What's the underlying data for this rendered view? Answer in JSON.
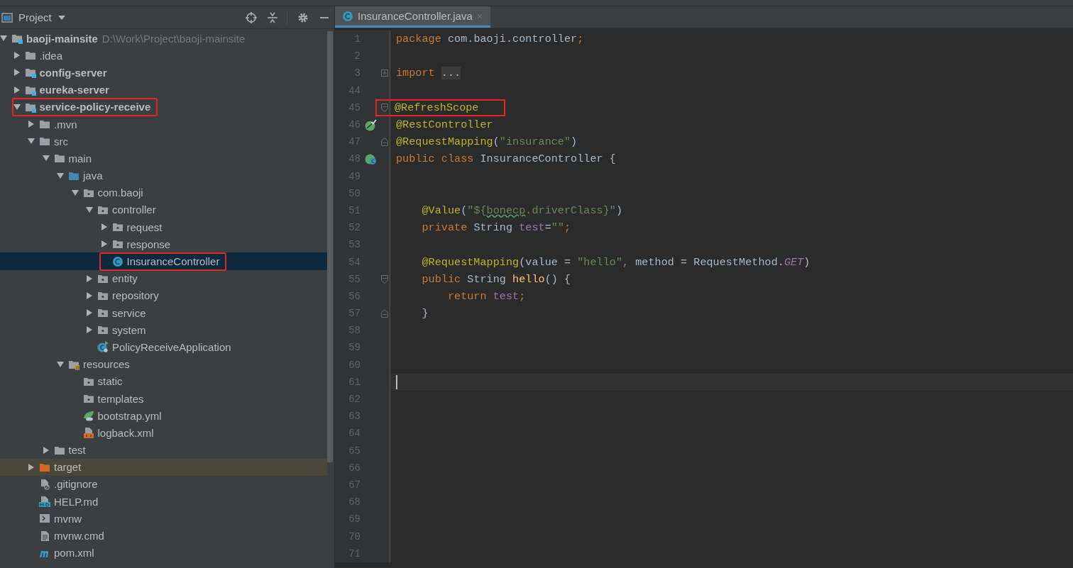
{
  "project_panel": {
    "title": "Project",
    "tree": [
      {
        "label": "baoji-mainsite",
        "kind": "module",
        "path": "D:\\Work\\Project\\baoji-mainsite",
        "expanded": true,
        "selected": false,
        "highlighted": false,
        "children": [
          {
            "label": ".idea",
            "kind": "folder",
            "expanded": false,
            "selected": false,
            "highlighted": false
          },
          {
            "label": "config-server",
            "kind": "module",
            "expanded": false,
            "selected": false,
            "highlighted": false
          },
          {
            "label": "eureka-server",
            "kind": "module",
            "expanded": false,
            "selected": false,
            "highlighted": false
          },
          {
            "label": "service-policy-receive",
            "kind": "module",
            "expanded": true,
            "selected": false,
            "highlighted": true,
            "children": [
              {
                "label": ".mvn",
                "kind": "folder",
                "expanded": false,
                "selected": false,
                "highlighted": false
              },
              {
                "label": "src",
                "kind": "folder",
                "expanded": true,
                "selected": false,
                "highlighted": false,
                "children": [
                  {
                    "label": "main",
                    "kind": "folder",
                    "expanded": true,
                    "selected": false,
                    "highlighted": false,
                    "children": [
                      {
                        "label": "java",
                        "kind": "source",
                        "expanded": true,
                        "selected": false,
                        "highlighted": false,
                        "children": [
                          {
                            "label": "com.baoji",
                            "kind": "package",
                            "expanded": true,
                            "selected": false,
                            "highlighted": false,
                            "children": [
                              {
                                "label": "controller",
                                "kind": "package",
                                "expanded": true,
                                "selected": false,
                                "highlighted": false,
                                "children": [
                                  {
                                    "label": "request",
                                    "kind": "package",
                                    "expanded": false,
                                    "selected": false,
                                    "highlighted": false
                                  },
                                  {
                                    "label": "response",
                                    "kind": "package",
                                    "expanded": false,
                                    "selected": false,
                                    "highlighted": false
                                  },
                                  {
                                    "label": "InsuranceController",
                                    "kind": "class",
                                    "selected": true,
                                    "highlighted": true
                                  }
                                ]
                              },
                              {
                                "label": "entity",
                                "kind": "package",
                                "expanded": false,
                                "selected": false,
                                "highlighted": false
                              },
                              {
                                "label": "repository",
                                "kind": "package",
                                "expanded": false,
                                "selected": false,
                                "highlighted": false
                              },
                              {
                                "label": "service",
                                "kind": "package",
                                "expanded": false,
                                "selected": false,
                                "highlighted": false
                              },
                              {
                                "label": "system",
                                "kind": "package",
                                "expanded": false,
                                "selected": false,
                                "highlighted": false
                              },
                              {
                                "label": "PolicyReceiveApplication",
                                "kind": "appclass",
                                "selected": false,
                                "highlighted": false
                              }
                            ]
                          }
                        ]
                      },
                      {
                        "label": "resources",
                        "kind": "resources",
                        "expanded": true,
                        "selected": false,
                        "highlighted": false,
                        "children": [
                          {
                            "label": "static",
                            "kind": "package",
                            "selected": false,
                            "highlighted": false
                          },
                          {
                            "label": "templates",
                            "kind": "package",
                            "selected": false,
                            "highlighted": false
                          },
                          {
                            "label": "bootstrap.yml",
                            "kind": "yml",
                            "selected": false,
                            "highlighted": false
                          },
                          {
                            "label": "logback.xml",
                            "kind": "xml",
                            "selected": false,
                            "highlighted": false
                          }
                        ]
                      }
                    ]
                  },
                  {
                    "label": "test",
                    "kind": "folder",
                    "expanded": false,
                    "selected": false,
                    "highlighted": false
                  }
                ]
              },
              {
                "label": "target",
                "kind": "excluded",
                "expanded": false,
                "selected": false,
                "highlighted": false
              },
              {
                "label": ".gitignore",
                "kind": "gitignore",
                "selected": false,
                "highlighted": false
              },
              {
                "label": "HELP.md",
                "kind": "md",
                "selected": false,
                "highlighted": false
              },
              {
                "label": "mvnw",
                "kind": "script",
                "selected": false,
                "highlighted": false
              },
              {
                "label": "mvnw.cmd",
                "kind": "cmd",
                "selected": false,
                "highlighted": false
              },
              {
                "label": "pom.xml",
                "kind": "maven",
                "selected": false,
                "highlighted": false
              }
            ]
          }
        ]
      }
    ]
  },
  "editor": {
    "tabs": [
      {
        "label": "InsuranceController.java",
        "close": "×",
        "selected": true
      }
    ],
    "lines": [
      {
        "number": "1",
        "tokens": [
          {
            "t": "package ",
            "kind": "kw"
          },
          {
            "t": "com.baoji.controller",
            "kind": "plain"
          },
          {
            "t": ";",
            "kind": "kw"
          }
        ]
      },
      {
        "number": "2"
      },
      {
        "number": "3",
        "fold": {
          "kind": "plus"
        },
        "tokens": [
          {
            "t": "import ",
            "kind": "kw"
          },
          {
            "t": "...",
            "kind": "folded"
          }
        ]
      },
      {
        "number": "44"
      },
      {
        "number": "45",
        "fold": {
          "kind": "start"
        },
        "highlighted": true,
        "tokens": [
          {
            "t": "@RefreshScope",
            "kind": "ann"
          }
        ]
      },
      {
        "number": "46",
        "gutter_icon": {
          "kind": "bean"
        },
        "tokens": [
          {
            "t": "@RestController",
            "kind": "ann"
          }
        ]
      },
      {
        "number": "47",
        "fold": {
          "kind": "end"
        },
        "tokens": [
          {
            "t": "@RequestMapping",
            "kind": "ann"
          },
          {
            "t": "(",
            "kind": "plain"
          },
          {
            "t": "\"insurance\"",
            "kind": "str"
          },
          {
            "t": ")",
            "kind": "plain"
          }
        ]
      },
      {
        "number": "48",
        "gutter_icon": {
          "kind": "class"
        },
        "tokens": [
          {
            "t": "public class ",
            "kind": "kw"
          },
          {
            "t": "InsuranceController {",
            "kind": "plain"
          }
        ]
      },
      {
        "number": "49"
      },
      {
        "number": "50"
      },
      {
        "number": "51",
        "tokens": [
          {
            "t": "    @Value",
            "kind": "ann"
          },
          {
            "t": "(",
            "kind": "plain"
          },
          {
            "t": "\"${",
            "kind": "str"
          },
          {
            "t": "bonecp",
            "kind": "typo"
          },
          {
            "t": ".driverClass}\"",
            "kind": "str"
          },
          {
            "t": ")",
            "kind": "plain"
          }
        ]
      },
      {
        "number": "52",
        "tokens": [
          {
            "t": "    private ",
            "kind": "kw"
          },
          {
            "t": "String ",
            "kind": "plain"
          },
          {
            "t": "test",
            "kind": "field"
          },
          {
            "t": "=",
            "kind": "plain"
          },
          {
            "t": "\"\"",
            "kind": "str"
          },
          {
            "t": ";",
            "kind": "kw"
          }
        ]
      },
      {
        "number": "53"
      },
      {
        "number": "54",
        "tokens": [
          {
            "t": "    @RequestMapping",
            "kind": "ann"
          },
          {
            "t": "(value = ",
            "kind": "plain"
          },
          {
            "t": "\"hello\"",
            "kind": "str"
          },
          {
            "t": ", ",
            "kind": "kw"
          },
          {
            "t": "method = RequestMethod.",
            "kind": "plain"
          },
          {
            "t": "GET",
            "kind": "const"
          },
          {
            "t": ")",
            "kind": "plain"
          }
        ]
      },
      {
        "number": "55",
        "fold": {
          "kind": "start"
        },
        "tokens": [
          {
            "t": "    public ",
            "kind": "kw"
          },
          {
            "t": "String ",
            "kind": "plain"
          },
          {
            "t": "hello",
            "kind": "method"
          },
          {
            "t": "() {",
            "kind": "plain"
          }
        ]
      },
      {
        "number": "56",
        "tokens": [
          {
            "t": "        return ",
            "kind": "kw"
          },
          {
            "t": "test",
            "kind": "field"
          },
          {
            "t": ";",
            "kind": "kw"
          }
        ]
      },
      {
        "number": "57",
        "fold": {
          "kind": "end"
        },
        "tokens": [
          {
            "t": "    }",
            "kind": "plain"
          }
        ]
      },
      {
        "number": "58"
      },
      {
        "number": "59"
      },
      {
        "number": "60"
      },
      {
        "number": "61",
        "current": true
      },
      {
        "number": "62"
      },
      {
        "number": "63"
      },
      {
        "number": "64"
      },
      {
        "number": "65"
      },
      {
        "number": "66"
      },
      {
        "number": "67"
      },
      {
        "number": "68"
      },
      {
        "number": "69"
      },
      {
        "number": "70"
      },
      {
        "number": "71"
      }
    ]
  }
}
